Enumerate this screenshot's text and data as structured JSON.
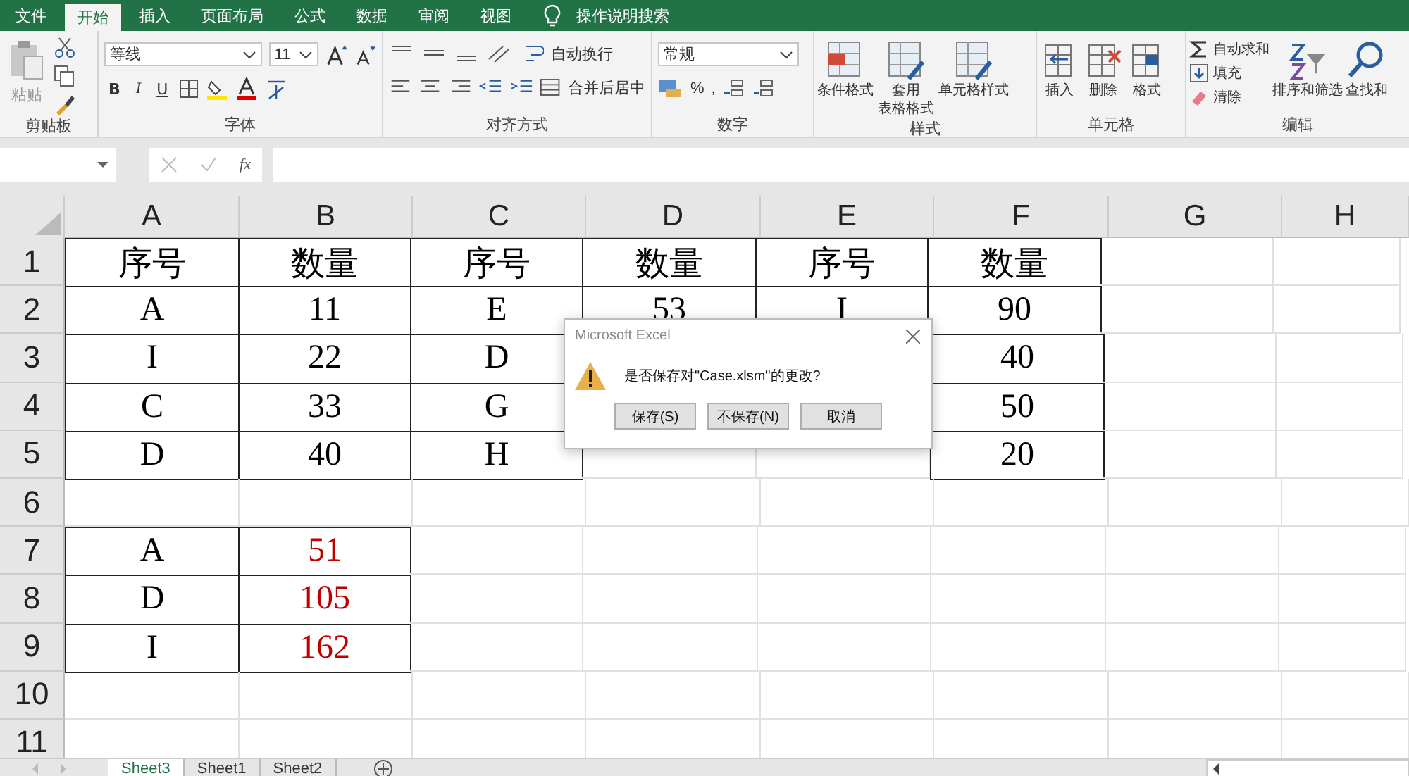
{
  "ribbon_tabs": [
    {
      "label": "文件",
      "selected": false
    },
    {
      "label": "开始",
      "selected": true
    },
    {
      "label": "插入",
      "selected": false
    },
    {
      "label": "页面布局",
      "selected": false
    },
    {
      "label": "公式",
      "selected": false
    },
    {
      "label": "数据",
      "selected": false
    },
    {
      "label": "审阅",
      "selected": false
    },
    {
      "label": "视图",
      "selected": false
    }
  ],
  "tell_me": "操作说明搜索",
  "clipboard": {
    "label": "剪贴板",
    "paste": "粘贴"
  },
  "font": {
    "label": "字体",
    "name": "等线",
    "size": "11",
    "bold": "B",
    "italic": "I",
    "underline": "U"
  },
  "alignment": {
    "label": "对齐方式",
    "wrap": "自动换行",
    "merge": "合并后居中"
  },
  "number": {
    "label": "数字",
    "format": "常规",
    "percent": "%",
    "comma": ","
  },
  "styles": {
    "label": "样式",
    "buttons": [
      {
        "lines": [
          "条件格式"
        ]
      },
      {
        "lines": [
          "套用",
          "表格格式"
        ]
      },
      {
        "lines": [
          "单元格样式"
        ]
      }
    ]
  },
  "cells_group": {
    "label": "单元格",
    "buttons": [
      "插入",
      "删除",
      "格式"
    ]
  },
  "editing": {
    "label": "编辑",
    "items": [
      "自动求和",
      "填充",
      "清除"
    ],
    "buttons": [
      "排序和筛选",
      "查找和"
    ]
  },
  "formula_bar": {
    "fx": "fx"
  },
  "sheet": {
    "columns": [
      "A",
      "B",
      "C",
      "D",
      "E",
      "F",
      "G",
      "H"
    ],
    "rows": [
      {
        "header": "1",
        "cells": [
          {
            "text": "序号",
            "color": "#000000"
          },
          {
            "text": "数量",
            "color": "#000000"
          },
          {
            "text": "序号",
            "color": "#000000"
          },
          {
            "text": "数量",
            "color": "#000000"
          },
          {
            "text": "序号",
            "color": "#000000"
          },
          {
            "text": "数量",
            "color": "#000000"
          }
        ]
      },
      {
        "header": "2",
        "cells": [
          {
            "text": "A",
            "color": "#000000"
          },
          {
            "text": "11",
            "color": "#000000"
          },
          {
            "text": "E",
            "color": "#000000"
          },
          {
            "text": "53",
            "color": "#000000"
          },
          {
            "text": "I",
            "color": "#000000"
          },
          {
            "text": "90",
            "color": "#000000"
          }
        ]
      },
      {
        "header": "3",
        "cells": [
          {
            "text": "I",
            "color": "#000000"
          },
          {
            "text": "22",
            "color": "#000000"
          },
          {
            "text": "D",
            "color": "#000000"
          },
          null,
          null,
          {
            "text": "40",
            "color": "#000000"
          }
        ]
      },
      {
        "header": "4",
        "cells": [
          {
            "text": "C",
            "color": "#000000"
          },
          {
            "text": "33",
            "color": "#000000"
          },
          {
            "text": "G",
            "color": "#000000"
          },
          null,
          null,
          {
            "text": "50",
            "color": "#000000"
          }
        ]
      },
      {
        "header": "5",
        "cells": [
          {
            "text": "D",
            "color": "#000000"
          },
          {
            "text": "40",
            "color": "#000000"
          },
          {
            "text": "H",
            "color": "#000000"
          },
          null,
          null,
          {
            "text": "20",
            "color": "#000000"
          }
        ]
      },
      {
        "header": "6",
        "cells": []
      },
      {
        "header": "7",
        "cells": [
          {
            "text": "A",
            "color": "#000000"
          },
          {
            "text": "51",
            "color": "#c00000"
          }
        ]
      },
      {
        "header": "8",
        "cells": [
          {
            "text": "D",
            "color": "#000000"
          },
          {
            "text": "105",
            "color": "#c00000"
          }
        ]
      },
      {
        "header": "9",
        "cells": [
          {
            "text": "I",
            "color": "#000000"
          },
          {
            "text": "162",
            "color": "#c00000"
          }
        ]
      },
      {
        "header": "10",
        "cells": []
      },
      {
        "header": "11",
        "cells": []
      }
    ]
  },
  "sheet_tabs": [
    {
      "label": "Sheet3",
      "selected": true
    },
    {
      "label": "Sheet1",
      "selected": false
    },
    {
      "label": "Sheet2",
      "selected": false
    }
  ],
  "dialog": {
    "title": "Microsoft Excel",
    "message": "是否保存对\"Case.xlsm\"的更改?",
    "buttons": [
      "保存(S)",
      "不保存(N)",
      "取消"
    ]
  }
}
